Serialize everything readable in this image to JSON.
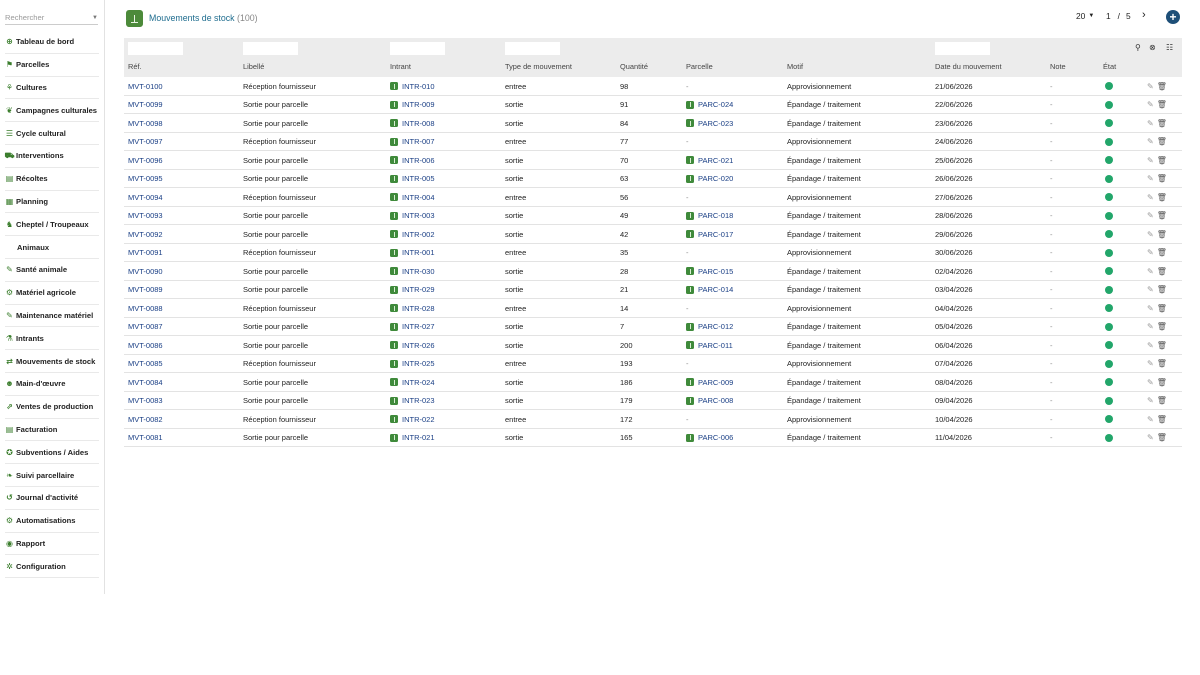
{
  "search": {
    "placeholder": "Rechercher"
  },
  "sidebar": {
    "items": [
      {
        "label": "Tableau de bord",
        "icon": "dashboard-icon",
        "glyph": "⊕",
        "sub": false
      },
      {
        "label": "Parcelles",
        "icon": "parcels-icon",
        "glyph": "⚑",
        "sub": false
      },
      {
        "label": "Cultures",
        "icon": "sprout-icon",
        "glyph": "⚘",
        "sub": false
      },
      {
        "label": "Campagnes culturales",
        "icon": "leaf-icon",
        "glyph": "❦",
        "sub": false
      },
      {
        "label": "Cycle cultural",
        "icon": "list-icon",
        "glyph": "☰",
        "sub": false
      },
      {
        "label": "Interventions",
        "icon": "tractor-icon",
        "glyph": "⛟",
        "sub": false
      },
      {
        "label": "Récoltes",
        "icon": "basket-icon",
        "glyph": "▤",
        "sub": false
      },
      {
        "label": "Planning",
        "icon": "calendar-icon",
        "glyph": "▦",
        "sub": false
      },
      {
        "label": "Cheptel / Troupeaux",
        "icon": "livestock-icon",
        "glyph": "♞",
        "sub": false
      },
      {
        "label": "Animaux",
        "icon": "",
        "glyph": "",
        "sub": true
      },
      {
        "label": "Santé animale",
        "icon": "syringe-icon",
        "glyph": "✎",
        "sub": false
      },
      {
        "label": "Matériel agricole",
        "icon": "equipment-icon",
        "glyph": "⚙",
        "sub": false
      },
      {
        "label": "Maintenance matériel",
        "icon": "wrench-icon",
        "glyph": "✎",
        "sub": false
      },
      {
        "label": "Intrants",
        "icon": "inputs-icon",
        "glyph": "⚗",
        "sub": false
      },
      {
        "label": "Mouvements de stock",
        "icon": "transfer-icon",
        "glyph": "⇄",
        "sub": false
      },
      {
        "label": "Main-d'œuvre",
        "icon": "worker-icon",
        "glyph": "☻",
        "sub": false
      },
      {
        "label": "Ventes de production",
        "icon": "sales-icon",
        "glyph": "⇗",
        "sub": false
      },
      {
        "label": "Facturation",
        "icon": "invoice-icon",
        "glyph": "▤",
        "sub": false
      },
      {
        "label": "Subventions / Aides",
        "icon": "grant-icon",
        "glyph": "✪",
        "sub": false
      },
      {
        "label": "Suivi parcellaire",
        "icon": "tracking-icon",
        "glyph": "❧",
        "sub": false
      },
      {
        "label": "Journal d'activité",
        "icon": "history-icon",
        "glyph": "↺",
        "sub": false
      },
      {
        "label": "Automatisations",
        "icon": "robot-icon",
        "glyph": "⚙",
        "sub": false
      },
      {
        "label": "Rapport",
        "icon": "report-icon",
        "glyph": "◉",
        "sub": false
      },
      {
        "label": "Configuration",
        "icon": "gear-icon",
        "glyph": "✲",
        "sub": false
      }
    ]
  },
  "header": {
    "title": "Mouvements de stock",
    "count": "(100)",
    "per_page": "20",
    "page_current": "1",
    "page_sep": "/",
    "page_total": "5",
    "next_glyph": "›",
    "add_glyph": "+"
  },
  "colors": {
    "link": "#1a3f85",
    "status_ok": "#22a66a",
    "brand": "#4c8a3a",
    "add_button": "#1e4f78"
  },
  "table": {
    "columns": [
      {
        "key": "ref",
        "label": "Réf."
      },
      {
        "key": "libelle",
        "label": "Libellé"
      },
      {
        "key": "intrant",
        "label": "Intrant"
      },
      {
        "key": "type",
        "label": "Type de mouvement"
      },
      {
        "key": "quantite",
        "label": "Quantité"
      },
      {
        "key": "parcelle",
        "label": "Parcelle"
      },
      {
        "key": "motif",
        "label": "Motif"
      },
      {
        "key": "date",
        "label": "Date du mouvement"
      },
      {
        "key": "note",
        "label": "Note"
      },
      {
        "key": "etat",
        "label": "État"
      }
    ],
    "rows": [
      {
        "ref": "MVT-0100",
        "libelle": "Réception fournisseur",
        "intrant": "INTR-010",
        "type": "entree",
        "quantite": "98",
        "parcelle": "",
        "motif": "Approvisionnement",
        "date": "21/06/2026",
        "note": "-"
      },
      {
        "ref": "MVT-0099",
        "libelle": "Sortie pour parcelle",
        "intrant": "INTR-009",
        "type": "sortie",
        "quantite": "91",
        "parcelle": "PARC-024",
        "motif": "Épandage / traitement",
        "date": "22/06/2026",
        "note": "-"
      },
      {
        "ref": "MVT-0098",
        "libelle": "Sortie pour parcelle",
        "intrant": "INTR-008",
        "type": "sortie",
        "quantite": "84",
        "parcelle": "PARC-023",
        "motif": "Épandage / traitement",
        "date": "23/06/2026",
        "note": "-"
      },
      {
        "ref": "MVT-0097",
        "libelle": "Réception fournisseur",
        "intrant": "INTR-007",
        "type": "entree",
        "quantite": "77",
        "parcelle": "",
        "motif": "Approvisionnement",
        "date": "24/06/2026",
        "note": "-"
      },
      {
        "ref": "MVT-0096",
        "libelle": "Sortie pour parcelle",
        "intrant": "INTR-006",
        "type": "sortie",
        "quantite": "70",
        "parcelle": "PARC-021",
        "motif": "Épandage / traitement",
        "date": "25/06/2026",
        "note": "-"
      },
      {
        "ref": "MVT-0095",
        "libelle": "Sortie pour parcelle",
        "intrant": "INTR-005",
        "type": "sortie",
        "quantite": "63",
        "parcelle": "PARC-020",
        "motif": "Épandage / traitement",
        "date": "26/06/2026",
        "note": "-"
      },
      {
        "ref": "MVT-0094",
        "libelle": "Réception fournisseur",
        "intrant": "INTR-004",
        "type": "entree",
        "quantite": "56",
        "parcelle": "",
        "motif": "Approvisionnement",
        "date": "27/06/2026",
        "note": "-"
      },
      {
        "ref": "MVT-0093",
        "libelle": "Sortie pour parcelle",
        "intrant": "INTR-003",
        "type": "sortie",
        "quantite": "49",
        "parcelle": "PARC-018",
        "motif": "Épandage / traitement",
        "date": "28/06/2026",
        "note": "-"
      },
      {
        "ref": "MVT-0092",
        "libelle": "Sortie pour parcelle",
        "intrant": "INTR-002",
        "type": "sortie",
        "quantite": "42",
        "parcelle": "PARC-017",
        "motif": "Épandage / traitement",
        "date": "29/06/2026",
        "note": "-"
      },
      {
        "ref": "MVT-0091",
        "libelle": "Réception fournisseur",
        "intrant": "INTR-001",
        "type": "entree",
        "quantite": "35",
        "parcelle": "",
        "motif": "Approvisionnement",
        "date": "30/06/2026",
        "note": "-"
      },
      {
        "ref": "MVT-0090",
        "libelle": "Sortie pour parcelle",
        "intrant": "INTR-030",
        "type": "sortie",
        "quantite": "28",
        "parcelle": "PARC-015",
        "motif": "Épandage / traitement",
        "date": "02/04/2026",
        "note": "-"
      },
      {
        "ref": "MVT-0089",
        "libelle": "Sortie pour parcelle",
        "intrant": "INTR-029",
        "type": "sortie",
        "quantite": "21",
        "parcelle": "PARC-014",
        "motif": "Épandage / traitement",
        "date": "03/04/2026",
        "note": "-"
      },
      {
        "ref": "MVT-0088",
        "libelle": "Réception fournisseur",
        "intrant": "INTR-028",
        "type": "entree",
        "quantite": "14",
        "parcelle": "",
        "motif": "Approvisionnement",
        "date": "04/04/2026",
        "note": "-"
      },
      {
        "ref": "MVT-0087",
        "libelle": "Sortie pour parcelle",
        "intrant": "INTR-027",
        "type": "sortie",
        "quantite": "7",
        "parcelle": "PARC-012",
        "motif": "Épandage / traitement",
        "date": "05/04/2026",
        "note": "-"
      },
      {
        "ref": "MVT-0086",
        "libelle": "Sortie pour parcelle",
        "intrant": "INTR-026",
        "type": "sortie",
        "quantite": "200",
        "parcelle": "PARC-011",
        "motif": "Épandage / traitement",
        "date": "06/04/2026",
        "note": "-"
      },
      {
        "ref": "MVT-0085",
        "libelle": "Réception fournisseur",
        "intrant": "INTR-025",
        "type": "entree",
        "quantite": "193",
        "parcelle": "",
        "motif": "Approvisionnement",
        "date": "07/04/2026",
        "note": "-"
      },
      {
        "ref": "MVT-0084",
        "libelle": "Sortie pour parcelle",
        "intrant": "INTR-024",
        "type": "sortie",
        "quantite": "186",
        "parcelle": "PARC-009",
        "motif": "Épandage / traitement",
        "date": "08/04/2026",
        "note": "-"
      },
      {
        "ref": "MVT-0083",
        "libelle": "Sortie pour parcelle",
        "intrant": "INTR-023",
        "type": "sortie",
        "quantite": "179",
        "parcelle": "PARC-008",
        "motif": "Épandage / traitement",
        "date": "09/04/2026",
        "note": "-"
      },
      {
        "ref": "MVT-0082",
        "libelle": "Réception fournisseur",
        "intrant": "INTR-022",
        "type": "entree",
        "quantite": "172",
        "parcelle": "",
        "motif": "Approvisionnement",
        "date": "10/04/2026",
        "note": "-"
      },
      {
        "ref": "MVT-0081",
        "libelle": "Sortie pour parcelle",
        "intrant": "INTR-021",
        "type": "sortie",
        "quantite": "165",
        "parcelle": "PARC-006",
        "motif": "Épandage / traitement",
        "date": "11/04/2026",
        "note": "-"
      }
    ],
    "empty_placeholder": "-",
    "status": "ok"
  }
}
